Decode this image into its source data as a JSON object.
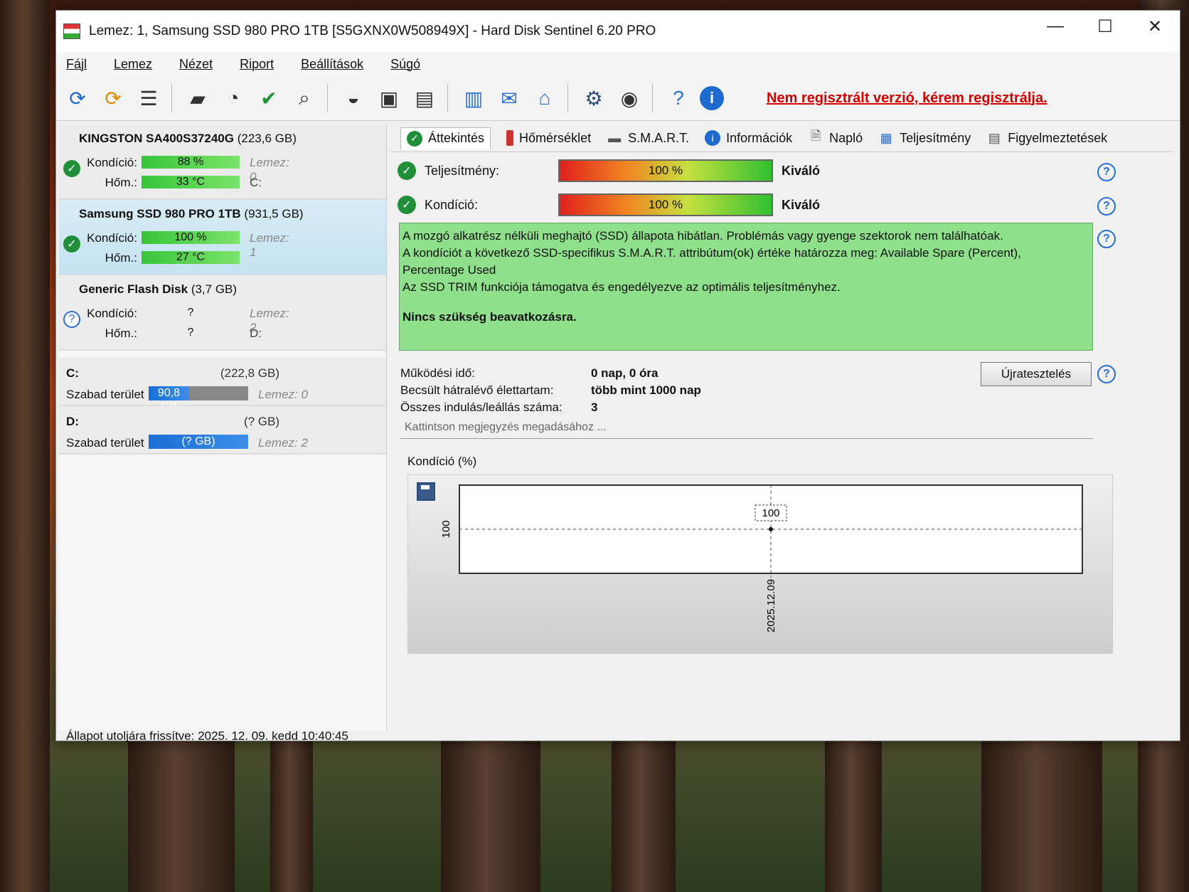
{
  "window": {
    "title": "Lemez: 1, Samsung SSD 980 PRO 1TB [S5GXNX0W508949X]  -  Hard Disk Sentinel 6.20 PRO",
    "controls": [
      "—",
      "☐",
      "✕"
    ]
  },
  "menu": [
    "Fájl",
    "Lemez",
    "Nézet",
    "Riport",
    "Beállítások",
    "Súgó"
  ],
  "toolbar": {
    "icons": [
      "refresh-icon",
      "refresh-warning-icon",
      "disk-list-icon",
      "drive-icon",
      "drive-clock-icon",
      "drive-check-icon",
      "drive-search-icon",
      "hdd-icon",
      "usb-drive-icon",
      "network-drive-icon",
      "report-icon",
      "email-icon",
      "network-icon",
      "gear-icon",
      "speaker-icon",
      "help-icon",
      "info-icon"
    ],
    "register_text": "Nem regisztrált verzió, kérem regisztrálja."
  },
  "disks": [
    {
      "name": "KINGSTON SA400S37240G",
      "size": "(223,6 GB)",
      "condition_label": "Kondíció:",
      "condition": "88 %",
      "condition_pct": 88,
      "temp_label": "Hőm.:",
      "temp": "33 °C",
      "disk_no": "Lemez: 0",
      "drive": "C:",
      "status": "ok",
      "selected": false
    },
    {
      "name": "Samsung SSD 980 PRO 1TB",
      "size": "(931,5 GB)",
      "condition_label": "Kondíció:",
      "condition": "100 %",
      "condition_pct": 100,
      "temp_label": "Hőm.:",
      "temp": "27 °C",
      "disk_no": "Lemez: 1",
      "drive": "",
      "status": "ok",
      "selected": true
    },
    {
      "name": "Generic Flash Disk",
      "size": "(3,7 GB)",
      "condition_label": "Kondíció:",
      "condition": "?",
      "condition_pct": 0,
      "temp_label": "Hőm.:",
      "temp": "?",
      "disk_no": "Lemez: 2",
      "drive": "D:",
      "status": "unknown",
      "selected": false
    }
  ],
  "partitions": [
    {
      "letter": "C:",
      "size": "(222,8 GB)",
      "free_label": "Szabad terület",
      "free": "90,8 GB",
      "free_fraction": 0.41,
      "disk_no": "Lemez: 0"
    },
    {
      "letter": "D:",
      "size": "(? GB)",
      "free_label": "Szabad terület",
      "free": "(? GB)",
      "free_fraction": 1.0,
      "disk_no": "Lemez: 2"
    }
  ],
  "tabs": [
    {
      "label": "Áttekintés",
      "icon": "check-icon",
      "active": true
    },
    {
      "label": "Hőmérséklet",
      "icon": "thermometer-icon",
      "active": false
    },
    {
      "label": "S.M.A.R.T.",
      "icon": "dash-icon",
      "active": false
    },
    {
      "label": "Információk",
      "icon": "info-icon",
      "active": false
    },
    {
      "label": "Napló",
      "icon": "document-icon",
      "active": false
    },
    {
      "label": "Teljesítmény",
      "icon": "chart-icon",
      "active": false
    },
    {
      "label": "Figyelmeztetések",
      "icon": "alerts-icon",
      "active": false
    }
  ],
  "overview": {
    "performance_label": "Teljesítmény:",
    "performance": "100 %",
    "performance_text": "Kiváló",
    "condition_label": "Kondíció:",
    "condition": "100 %",
    "condition_text": "Kiváló",
    "info_lines": [
      "A mozgó alkatrész nélküli meghajtó (SSD) állapota hibátlan. Problémás vagy gyenge szektorok nem találhatóak.",
      "A kondíciót a következő SSD-specifikus S.M.A.R.T. attribútum(ok) értéke határozza meg:  Available Spare (Percent),",
      "Percentage Used",
      "Az SSD TRIM funkciója támogatva és engedélyezve az optimális teljesítményhez."
    ],
    "info_bold": "Nincs szükség beavatkozásra.",
    "uptime_label": "Működési idő:",
    "uptime": "0 nap, 0 óra",
    "remaining_label": "Becsült hátralévő élettartam:",
    "remaining": "több mint 1000 nap",
    "starts_label": "Összes indulás/leállás száma:",
    "starts": "3",
    "retest_button": "Újratesztelés",
    "note_placeholder": "Kattintson megjegyzés megadásához ..."
  },
  "chart_data": {
    "type": "line",
    "title": "Kondíció  (%)",
    "x": [
      "2025.12.09"
    ],
    "series": [
      {
        "values": [
          100
        ]
      }
    ],
    "y_tick": "100",
    "data_label": "100",
    "grid": true
  },
  "statusbar": "Állapot utoljára frissítve: 2025. 12. 09. kedd 10:40:45"
}
